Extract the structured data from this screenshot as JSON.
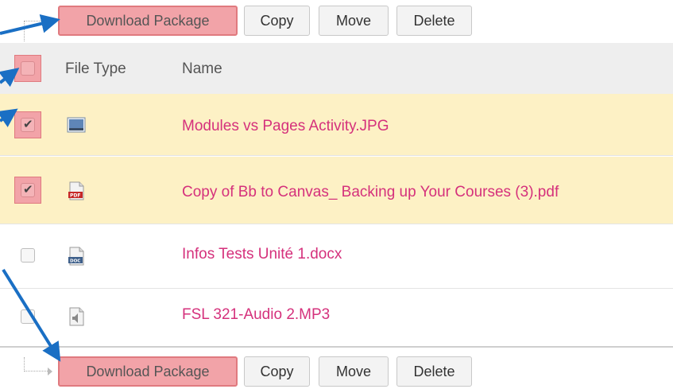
{
  "toolbar_top": {
    "download_label": "Download Package",
    "copy_label": "Copy",
    "move_label": "Move",
    "delete_label": "Delete"
  },
  "toolbar_bottom": {
    "download_label": "Download Package",
    "copy_label": "Copy",
    "move_label": "Move",
    "delete_label": "Delete"
  },
  "grid": {
    "columns": [
      "File Type",
      "Name"
    ],
    "rows": [
      {
        "name": "Modules vs Pages Activity.JPG",
        "icon": "image-file-icon",
        "checked": true
      },
      {
        "name": "Copy of Bb to Canvas_ Backing up Your Courses (3).pdf",
        "icon": "pdf-file-icon",
        "checked": true
      },
      {
        "name": "Infos Tests Unité 1.docx",
        "icon": "doc-file-icon",
        "checked": false
      },
      {
        "name": "FSL 321-Audio 2.MP3",
        "icon": "audio-file-icon",
        "checked": false
      }
    ]
  },
  "colors": {
    "highlight": "#f2a3a8",
    "selected_row": "#fdf1c5",
    "link": "#d5317c",
    "annotation_arrow": "#1a6fc4"
  }
}
